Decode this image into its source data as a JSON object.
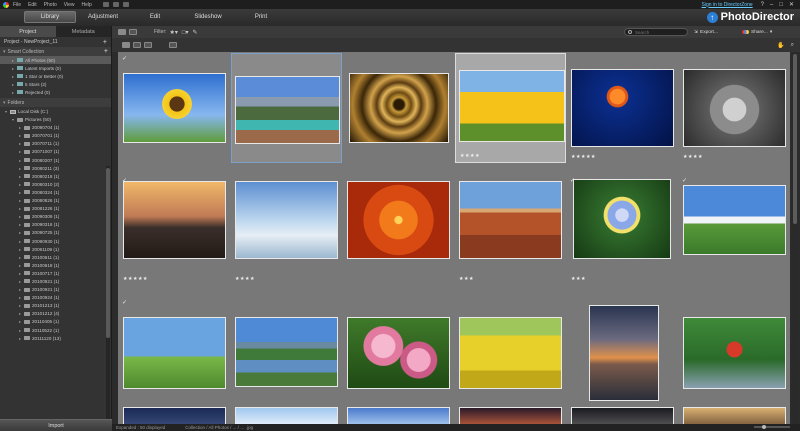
{
  "app": {
    "name": "PhotoDirector",
    "menus": [
      "File",
      "Edit",
      "Photo",
      "View",
      "Help"
    ],
    "sign_in": "Sign in to DirectorZone",
    "window_controls": [
      "?",
      "–",
      "□",
      "✕"
    ]
  },
  "tabs": [
    {
      "label": "Library",
      "active": true
    },
    {
      "label": "Adjustment",
      "active": false
    },
    {
      "label": "Edit",
      "active": false
    },
    {
      "label": "Slideshow",
      "active": false
    },
    {
      "label": "Print",
      "active": false
    }
  ],
  "left_panel": {
    "tabs": [
      {
        "label": "Project",
        "active": true
      },
      {
        "label": "Metadata",
        "active": false
      }
    ],
    "project_name": "Project - NewProject_11",
    "smart_collection_header": "Smart Collection",
    "smart_collections": [
      {
        "label": "All Photos (50)",
        "selected": true
      },
      {
        "label": "Latest Imports (0)",
        "selected": false
      },
      {
        "label": "1 Star or Better (0)",
        "selected": false
      },
      {
        "label": "5 Stars (2)",
        "selected": false
      },
      {
        "label": "Rejected (0)",
        "selected": false
      }
    ],
    "folders_header": "Folders",
    "local_disk": "Local Disk (C:)",
    "pictures": "Pictures (50)",
    "folders": [
      "20090704 (1)",
      "20070701 (1)",
      "20070711 (1)",
      "20071007 (1)",
      "20080207 (1)",
      "20080211 (3)",
      "20080218 (1)",
      "20080310 (2)",
      "20080324 (1)",
      "20080826 (1)",
      "20081226 (1)",
      "20090309 (1)",
      "20090316 (1)",
      "20090725 (1)",
      "20090930 (1)",
      "20091109 (1)",
      "20100611 (1)",
      "20100618 (1)",
      "20100717 (1)",
      "20100821 (1)",
      "20100921 (1)",
      "20100924 (1)",
      "20101213 (1)",
      "20101212 (4)",
      "20110405 (1)",
      "20110522 (1)",
      "20111120 (13)"
    ],
    "import_label": "Import"
  },
  "toolbar": {
    "filter_label": "Filter:",
    "search_placeholder": "Search",
    "export_label": "Export...",
    "share_label": "Share..."
  },
  "thumbnails": [
    {
      "subject": "sunflower",
      "stars": "",
      "mark": "✓"
    },
    {
      "subject": "mountain lake",
      "stars": "",
      "mark": "",
      "state": "hover"
    },
    {
      "subject": "spiral staircase",
      "stars": "",
      "mark": ""
    },
    {
      "subject": "yellow tulips",
      "stars": "★★★★",
      "mark": "",
      "state": "selected"
    },
    {
      "subject": "jellyfish",
      "stars": "★★★★★",
      "mark": ""
    },
    {
      "subject": "koala",
      "stars": "★★★★",
      "mark": ""
    },
    {
      "subject": "lighthouse",
      "stars": "★★★★★",
      "mark": "✓"
    },
    {
      "subject": "penguins",
      "stars": "★★★★",
      "mark": ""
    },
    {
      "subject": "orange flower",
      "stars": "",
      "mark": ""
    },
    {
      "subject": "desert butte",
      "stars": "★★★",
      "mark": ""
    },
    {
      "subject": "hydrangea",
      "stars": "★★★",
      "mark": "✓"
    },
    {
      "subject": "green hills",
      "stars": "",
      "mark": "✓"
    },
    {
      "subject": "bicycles field",
      "stars": "",
      "mark": "✓"
    },
    {
      "subject": "lake valley",
      "stars": "",
      "mark": ""
    },
    {
      "subject": "cherry blossoms",
      "stars": "",
      "mark": ""
    },
    {
      "subject": "bicycle yellow flowers",
      "stars": "",
      "mark": ""
    },
    {
      "subject": "sunset sea",
      "stars": "",
      "mark": ""
    },
    {
      "subject": "red pagoda",
      "stars": "",
      "mark": ""
    }
  ],
  "status": {
    "left": "Expanded : 50 displayed",
    "middle": "Collection / All Photos / ... / … .jpg"
  },
  "colors": {
    "accent": "#2c7fd6",
    "grid_bg": "#787878",
    "selected_bg": "#a8a8a8"
  }
}
